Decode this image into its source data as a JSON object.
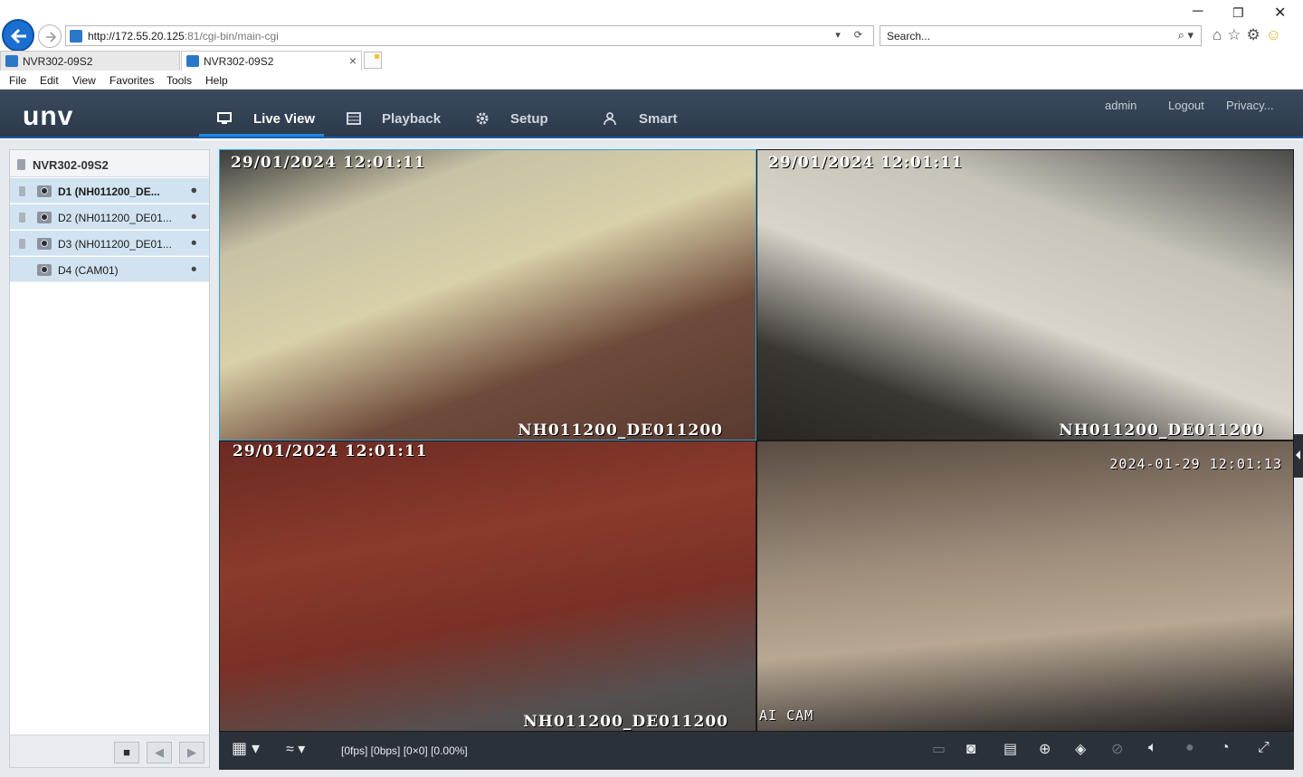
{
  "browser": {
    "address_host": "http://172.55.20.125",
    "address_port_path": ":81/cgi-bin/main-cgi",
    "search_placeholder": "Search...",
    "tabs": [
      {
        "label": "NVR302-09S2"
      },
      {
        "label": "NVR302-09S2"
      }
    ],
    "tab_close": "×",
    "menu": [
      "File",
      "Edit",
      "View",
      "Favorites",
      "Tools",
      "Help"
    ],
    "win_min": "─",
    "win_restore": "❐",
    "win_close": "✕"
  },
  "app": {
    "logo": "unv",
    "nav": [
      {
        "label": "Live View",
        "active": true,
        "icon": "monitor-icon"
      },
      {
        "label": "Playback",
        "active": false,
        "icon": "film-icon"
      },
      {
        "label": "Setup",
        "active": false,
        "icon": "gear-icon"
      },
      {
        "label": "Smart",
        "active": false,
        "icon": "person-icon"
      }
    ],
    "user": "admin",
    "logout": "Logout",
    "privacy": "Privacy..."
  },
  "sidebar": {
    "device": "NVR302-09S2",
    "cameras": [
      {
        "label": "D1 (NH011200_DE...",
        "bold": true
      },
      {
        "label": "D2 (NH011200_DE01...",
        "bold": false
      },
      {
        "label": "D3 (NH011200_DE01...",
        "bold": false
      },
      {
        "label": "D4 (CAM01)",
        "bold": false
      }
    ]
  },
  "tiles": [
    {
      "timestamp": "29/01/2024  12:01:11",
      "name": "NH011200_DE011200"
    },
    {
      "timestamp": "29/01/2024  12:01:11",
      "name": "NH011200_DE011200"
    },
    {
      "timestamp": "29/01/2024  12:01:11",
      "name": "NH011200_DE011200"
    },
    {
      "timestamp": "2024-01-29  12:01:13",
      "name": "AI CAM"
    }
  ],
  "toolbar": {
    "stats": "[0fps] [0bps] [0×0] [0.00%]"
  }
}
